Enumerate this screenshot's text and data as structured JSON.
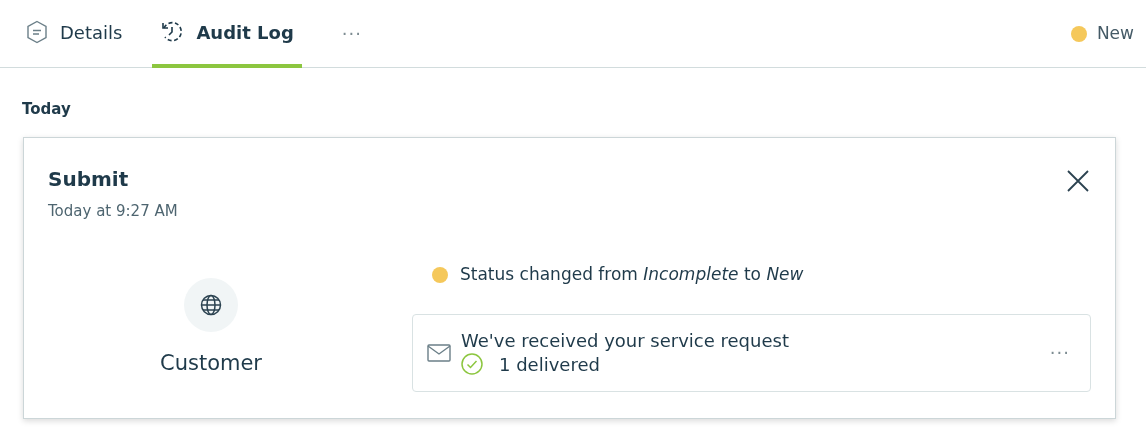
{
  "tabs": [
    {
      "label": "Details",
      "kind": "details",
      "selected": false
    },
    {
      "label": "Audit Log",
      "kind": "audit",
      "selected": true
    }
  ],
  "more_tabs": "···",
  "record_status": {
    "label": "New",
    "color": "#f5c85b"
  },
  "section": "Today",
  "entry": {
    "title": "Submit",
    "time": "Today at 9:27 AM",
    "actor": "Customer",
    "status_change": {
      "text": "Status changed from *Incomplete* to *New*",
      "color": "#f5c85b"
    },
    "message": {
      "subject": "We've received your service request",
      "delivery": "1 delivered",
      "more": "···"
    }
  }
}
